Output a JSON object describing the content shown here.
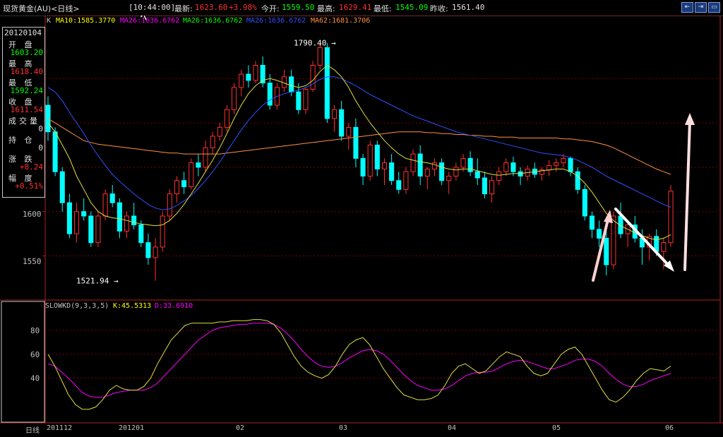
{
  "header": {
    "instrument": "现货黄金(AU)<日线>",
    "time": "[10:44:00]",
    "latest_label": "最新:",
    "latest_value": "1623.60",
    "change_value": "+3.98%",
    "open_label": "今开:",
    "open_value": "1559.50",
    "high_label": "最高:",
    "high_value": "1629.41",
    "low_label": "最低:",
    "low_value": "1545.09",
    "prev_label": "昨收:",
    "prev_value": "1561.40",
    "window_buttons": [
      "⇤",
      "⇥",
      "▭"
    ]
  },
  "infopanel": {
    "date": "20120104",
    "rows": [
      {
        "label": "开 盘",
        "value": "1603.20",
        "color": "#00ff00"
      },
      {
        "label": "最 高",
        "value": "1618.40",
        "color": "#ff3030"
      },
      {
        "label": "最 低",
        "value": "1592.24",
        "color": "#00ff00"
      },
      {
        "label": "收 盘",
        "value": "1611.54",
        "color": "#ff3030"
      },
      {
        "label": "成交量",
        "value": "0",
        "color": "#e0e0e0"
      },
      {
        "label": "持 仓",
        "value": "0",
        "color": "#e0e0e0"
      },
      {
        "label": "涨 跌",
        "value": "+8.24",
        "color": "#ff3030"
      },
      {
        "label": "幅 度",
        "value": "+0.51%",
        "color": "#ff3030"
      }
    ]
  },
  "ma_captions": {
    "k": "K",
    "ma10": "MA10:1585.3770",
    "ma26a": "MA26:1636.6762",
    "ma26b": "MA26:1636.6762",
    "ma26c": "MA26:1636.6762",
    "ma62": "MA62:1681.3706",
    "colors": {
      "ma10": "#ffff00",
      "ma26a": "#ff00ff",
      "ma26b": "#00ff00",
      "ma26c": "#3050ff",
      "ma62": "#ff9040"
    }
  },
  "kd_captions": {
    "name": "SLOWKD(9,3,3,5)",
    "k": "K:45.5313",
    "d": "D:33.6910"
  },
  "chart_data": {
    "type": "candlestick",
    "title": "现货黄金(AU)<日线>",
    "y_ticks": [
      1550,
      1600
    ],
    "y_range": [
      1505,
      1810
    ],
    "annotations": [
      {
        "text": "1790.40",
        "value": 1790.4
      },
      {
        "text": "1521.94",
        "value": 1521.94
      }
    ],
    "x_labels": [
      "日线",
      "201112",
      "201201",
      "02",
      "03",
      "04",
      "05",
      "06"
    ],
    "candles_ohlc": [
      [
        1720,
        1730,
        1680,
        1690
      ],
      [
        1690,
        1695,
        1640,
        1645
      ],
      [
        1645,
        1650,
        1600,
        1610
      ],
      [
        1610,
        1620,
        1570,
        1575
      ],
      [
        1575,
        1610,
        1565,
        1600
      ],
      [
        1600,
        1615,
        1590,
        1595
      ],
      [
        1595,
        1600,
        1560,
        1565
      ],
      [
        1565,
        1600,
        1560,
        1595
      ],
      [
        1595,
        1625,
        1590,
        1620
      ],
      [
        1620,
        1630,
        1605,
        1610
      ],
      [
        1610,
        1615,
        1570,
        1578
      ],
      [
        1578,
        1600,
        1570,
        1595
      ],
      [
        1595,
        1610,
        1580,
        1585
      ],
      [
        1585,
        1590,
        1560,
        1565
      ],
      [
        1565,
        1575,
        1540,
        1548
      ],
      [
        1548,
        1570,
        1522,
        1560
      ],
      [
        1560,
        1600,
        1555,
        1595
      ],
      [
        1595,
        1625,
        1590,
        1620
      ],
      [
        1620,
        1640,
        1610,
        1635
      ],
      [
        1635,
        1645,
        1620,
        1628
      ],
      [
        1628,
        1660,
        1625,
        1655
      ],
      [
        1655,
        1665,
        1640,
        1650
      ],
      [
        1650,
        1680,
        1645,
        1672
      ],
      [
        1672,
        1690,
        1665,
        1685
      ],
      [
        1685,
        1700,
        1680,
        1695
      ],
      [
        1695,
        1720,
        1690,
        1715
      ],
      [
        1715,
        1745,
        1710,
        1740
      ],
      [
        1740,
        1760,
        1730,
        1755
      ],
      [
        1755,
        1765,
        1740,
        1748
      ],
      [
        1748,
        1770,
        1745,
        1765
      ],
      [
        1765,
        1775,
        1740,
        1745
      ],
      [
        1745,
        1755,
        1715,
        1720
      ],
      [
        1720,
        1745,
        1715,
        1740
      ],
      [
        1740,
        1760,
        1735,
        1752
      ],
      [
        1752,
        1760,
        1730,
        1735
      ],
      [
        1735,
        1745,
        1710,
        1715
      ],
      [
        1715,
        1740,
        1710,
        1738
      ],
      [
        1738,
        1770,
        1735,
        1765
      ],
      [
        1765,
        1790,
        1760,
        1785
      ],
      [
        1785,
        1790,
        1700,
        1705
      ],
      [
        1705,
        1720,
        1690,
        1715
      ],
      [
        1715,
        1725,
        1680,
        1685
      ],
      [
        1685,
        1700,
        1670,
        1695
      ],
      [
        1695,
        1705,
        1650,
        1660
      ],
      [
        1660,
        1665,
        1630,
        1640
      ],
      [
        1640,
        1680,
        1635,
        1675
      ],
      [
        1675,
        1680,
        1640,
        1648
      ],
      [
        1648,
        1660,
        1630,
        1655
      ],
      [
        1655,
        1665,
        1630,
        1635
      ],
      [
        1635,
        1645,
        1620,
        1625
      ],
      [
        1625,
        1650,
        1620,
        1645
      ],
      [
        1645,
        1670,
        1640,
        1665
      ],
      [
        1665,
        1675,
        1630,
        1640
      ],
      [
        1640,
        1650,
        1625,
        1648
      ],
      [
        1648,
        1660,
        1640,
        1655
      ],
      [
        1655,
        1660,
        1630,
        1635
      ],
      [
        1635,
        1645,
        1620,
        1640
      ],
      [
        1640,
        1655,
        1635,
        1650
      ],
      [
        1650,
        1665,
        1645,
        1660
      ],
      [
        1660,
        1668,
        1640,
        1645
      ],
      [
        1645,
        1660,
        1630,
        1638
      ],
      [
        1638,
        1645,
        1615,
        1620
      ],
      [
        1620,
        1640,
        1610,
        1635
      ],
      [
        1635,
        1650,
        1630,
        1645
      ],
      [
        1645,
        1660,
        1640,
        1655
      ],
      [
        1655,
        1662,
        1640,
        1645
      ],
      [
        1645,
        1650,
        1630,
        1640
      ],
      [
        1640,
        1652,
        1635,
        1648
      ],
      [
        1648,
        1655,
        1638,
        1642
      ],
      [
        1642,
        1650,
        1635,
        1647
      ],
      [
        1647,
        1658,
        1640,
        1652
      ],
      [
        1652,
        1660,
        1645,
        1655
      ],
      [
        1655,
        1665,
        1650,
        1660
      ],
      [
        1660,
        1662,
        1640,
        1645
      ],
      [
        1645,
        1650,
        1620,
        1625
      ],
      [
        1625,
        1630,
        1590,
        1595
      ],
      [
        1595,
        1600,
        1570,
        1580
      ],
      [
        1580,
        1590,
        1560,
        1570
      ],
      [
        1570,
        1580,
        1528,
        1540
      ],
      [
        1540,
        1600,
        1535,
        1595
      ],
      [
        1595,
        1610,
        1570,
        1575
      ],
      [
        1575,
        1590,
        1560,
        1585
      ],
      [
        1585,
        1595,
        1565,
        1570
      ],
      [
        1570,
        1580,
        1540,
        1560
      ],
      [
        1560,
        1575,
        1545,
        1572
      ],
      [
        1572,
        1580,
        1550,
        1555
      ],
      [
        1555,
        1570,
        1535,
        1565
      ],
      [
        1565,
        1630,
        1560,
        1623
      ]
    ],
    "ma_yellow_ma10": [
      1700,
      1690,
      1675,
      1660,
      1640,
      1625,
      1610,
      1600,
      1595,
      1593,
      1592,
      1590,
      1588,
      1586,
      1585,
      1584,
      1585,
      1590,
      1598,
      1608,
      1620,
      1632,
      1645,
      1658,
      1672,
      1688,
      1705,
      1720,
      1733,
      1742,
      1748,
      1750,
      1748,
      1745,
      1742,
      1740,
      1742,
      1748,
      1758,
      1765,
      1760,
      1752,
      1740,
      1725,
      1712,
      1700,
      1690,
      1680,
      1672,
      1665,
      1660,
      1658,
      1656,
      1655,
      1653,
      1650,
      1648,
      1647,
      1648,
      1648,
      1646,
      1644,
      1642,
      1641,
      1642,
      1643,
      1643,
      1644,
      1645,
      1646,
      1647,
      1648,
      1648,
      1645,
      1640,
      1632,
      1622,
      1610,
      1598,
      1590,
      1584,
      1580,
      1576,
      1573,
      1570,
      1568,
      1570,
      1574
    ],
    "ma_blue_ma26": [
      1740,
      1735,
      1725,
      1712,
      1700,
      1688,
      1675,
      1663,
      1652,
      1642,
      1634,
      1627,
      1620,
      1614,
      1608,
      1604,
      1602,
      1603,
      1607,
      1612,
      1618,
      1626,
      1635,
      1645,
      1656,
      1668,
      1680,
      1692,
      1703,
      1712,
      1720,
      1726,
      1730,
      1733,
      1735,
      1737,
      1740,
      1744,
      1749,
      1752,
      1752,
      1750,
      1746,
      1742,
      1737,
      1732,
      1728,
      1724,
      1720,
      1716,
      1712,
      1708,
      1705,
      1702,
      1699,
      1696,
      1693,
      1690,
      1688,
      1686,
      1684,
      1682,
      1680,
      1678,
      1676,
      1674,
      1672,
      1670,
      1668,
      1666,
      1665,
      1664,
      1663,
      1661,
      1658,
      1654,
      1650,
      1645,
      1640,
      1636,
      1632,
      1628,
      1624,
      1620,
      1616,
      1612,
      1608,
      1605
    ],
    "ma_orange_ma62": [
      1705,
      1700,
      1695,
      1690,
      1685,
      1680,
      1678,
      1676,
      1675,
      1674,
      1673,
      1672,
      1671,
      1670,
      1669,
      1668,
      1667,
      1666,
      1666,
      1665,
      1665,
      1665,
      1665,
      1665,
      1665,
      1666,
      1667,
      1668,
      1669,
      1670,
      1671,
      1672,
      1673,
      1674,
      1675,
      1676,
      1677,
      1678,
      1679,
      1680,
      1681,
      1682,
      1683,
      1684,
      1685,
      1686,
      1687,
      1688,
      1689,
      1690,
      1690,
      1690,
      1690,
      1689,
      1689,
      1688,
      1688,
      1687,
      1687,
      1686,
      1686,
      1685,
      1685,
      1684,
      1684,
      1684,
      1683,
      1683,
      1683,
      1683,
      1683,
      1683,
      1682,
      1682,
      1681,
      1680,
      1679,
      1677,
      1675,
      1672,
      1668,
      1664,
      1660,
      1656,
      1652,
      1648,
      1645,
      1642
    ],
    "kd_y_ticks": [
      40,
      60,
      80
    ],
    "kd_y_range": [
      5,
      100
    ],
    "kd_k": [
      60,
      50,
      38,
      26,
      18,
      14,
      14,
      16,
      22,
      30,
      34,
      31,
      30,
      30,
      33,
      40,
      52,
      62,
      72,
      78,
      84,
      86,
      86,
      86,
      86,
      87,
      87,
      88,
      88,
      88,
      89,
      89,
      88,
      85,
      78,
      68,
      58,
      50,
      45,
      42,
      40,
      43,
      50,
      60,
      68,
      72,
      74,
      68,
      58,
      48,
      40,
      32,
      26,
      24,
      22,
      22,
      23,
      26,
      34,
      44,
      50,
      52,
      48,
      44,
      46,
      52,
      58,
      62,
      60,
      58,
      50,
      44,
      42,
      44,
      52,
      60,
      64,
      66,
      60,
      50,
      40,
      30,
      22,
      20,
      24,
      30,
      38,
      44,
      48,
      47,
      46,
      50
    ],
    "kd_d": [
      52,
      50,
      45,
      40,
      34,
      28,
      25,
      24,
      24,
      26,
      28,
      29,
      30,
      30,
      30,
      32,
      36,
      42,
      48,
      54,
      60,
      66,
      72,
      76,
      80,
      82,
      83,
      84,
      85,
      85,
      86,
      86,
      86,
      85,
      82,
      77,
      71,
      64,
      58,
      53,
      50,
      49,
      50,
      53,
      57,
      60,
      63,
      64,
      63,
      60,
      55,
      49,
      43,
      38,
      34,
      32,
      30,
      30,
      31,
      34,
      38,
      42,
      44,
      45,
      45,
      46,
      49,
      52,
      54,
      55,
      54,
      52,
      50,
      48,
      48,
      50,
      52,
      55,
      56,
      56,
      54,
      50,
      44,
      39,
      35,
      33,
      33,
      35,
      38,
      40,
      42,
      44
    ]
  }
}
